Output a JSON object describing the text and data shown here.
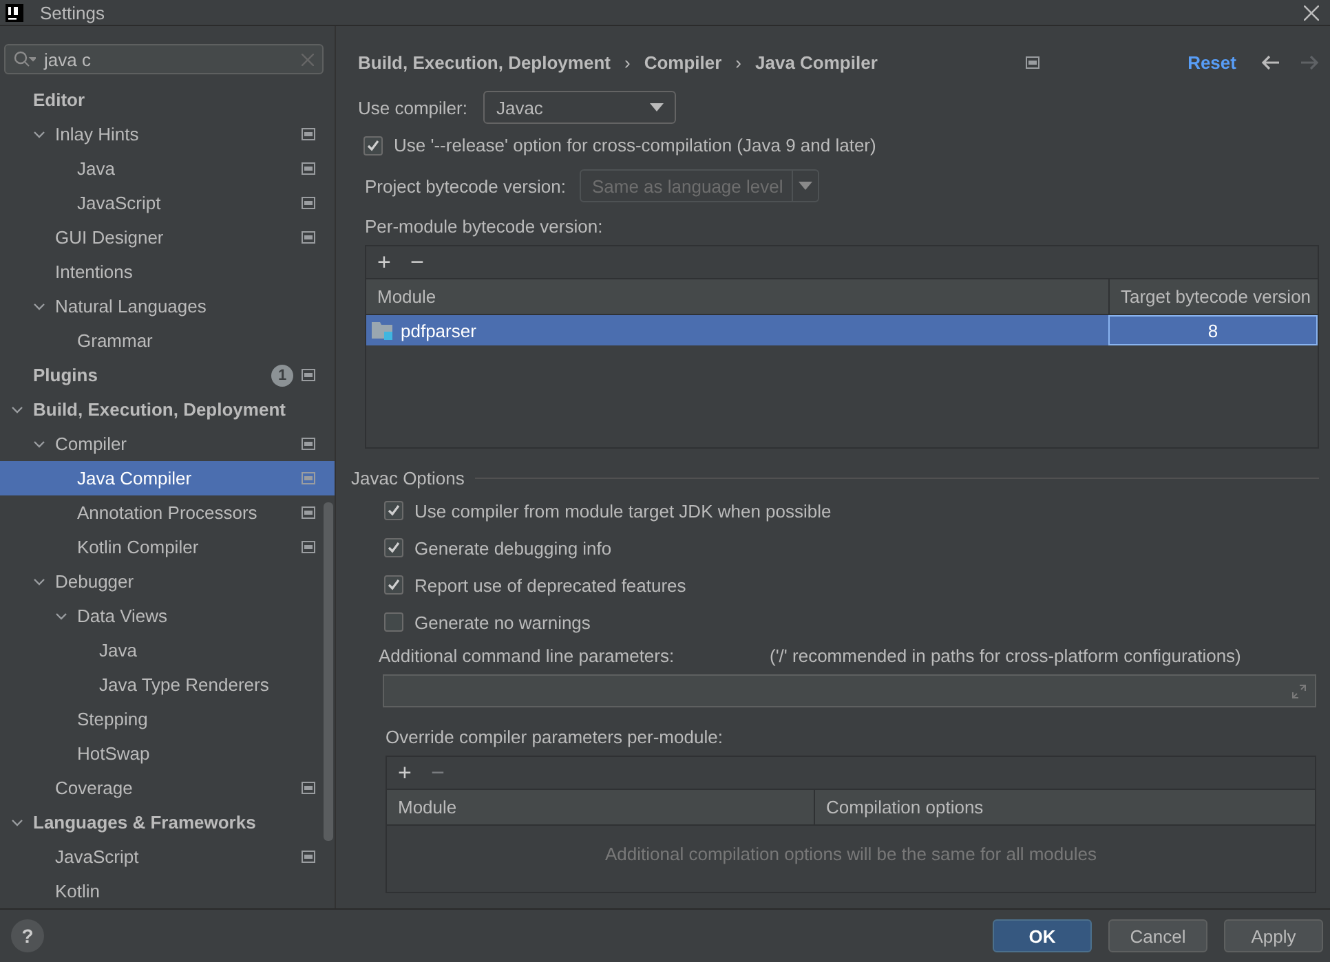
{
  "window": {
    "title": "Settings"
  },
  "search": {
    "value": "java c"
  },
  "sidebar": {
    "items": [
      {
        "label": "Editor",
        "children": [
          {
            "label": "Inlay Hints",
            "expanded": true,
            "project_level": true,
            "children": [
              {
                "label": "Java",
                "project_level": true
              },
              {
                "label": "JavaScript",
                "project_level": true
              }
            ]
          },
          {
            "label": "GUI Designer",
            "project_level": true
          },
          {
            "label": "Intentions",
            "project_level": false
          },
          {
            "label": "Natural Languages",
            "expanded": true,
            "project_level": false,
            "children": [
              {
                "label": "Grammar",
                "project_level": false
              }
            ]
          }
        ]
      },
      {
        "label": "Plugins",
        "badge": "1",
        "project_level": true
      },
      {
        "label": "Build, Execution, Deployment",
        "expanded": true,
        "children": [
          {
            "label": "Compiler",
            "expanded": true,
            "project_level": true,
            "children": [
              {
                "label": "Java Compiler",
                "project_level": true,
                "selected": true
              },
              {
                "label": "Annotation Processors",
                "project_level": true,
                "selected": false
              },
              {
                "label": "Kotlin Compiler",
                "project_level": true,
                "selected": false
              }
            ]
          },
          {
            "label": "Debugger",
            "expanded": true,
            "project_level": false,
            "children": [
              {
                "label": "Data Views",
                "expanded": true,
                "project_level": false,
                "children": [
                  {
                    "label": "Java",
                    "project_level": false
                  },
                  {
                    "label": "Java Type Renderers",
                    "project_level": false
                  }
                ]
              },
              {
                "label": "Stepping",
                "project_level": false
              },
              {
                "label": "HotSwap",
                "project_level": false
              }
            ]
          },
          {
            "label": "Coverage",
            "project_level": true
          }
        ]
      },
      {
        "label": "Languages & Frameworks",
        "expanded": true,
        "children": [
          {
            "label": "JavaScript",
            "project_level": true
          },
          {
            "label": "Kotlin",
            "project_level": false
          }
        ]
      }
    ]
  },
  "breadcrumb": [
    "Build, Execution, Deployment",
    "Compiler",
    "Java Compiler"
  ],
  "breadcrumb_separator": "›",
  "reset_link": "Reset",
  "use_compiler": {
    "label": "Use compiler:",
    "value": "Javac"
  },
  "release_option": {
    "label": "Use '--release' option for cross-compilation (Java 9 and later)",
    "checked": true
  },
  "project_bytecode": {
    "label": "Project bytecode version:",
    "value": "Same as language level",
    "disabled": true
  },
  "per_module": {
    "label": "Per-module bytecode version:",
    "toolbar": [
      {
        "symbol": "+",
        "disabled": false
      },
      {
        "symbol": "−",
        "disabled": false
      }
    ],
    "columns": [
      "Module",
      "Target bytecode version"
    ],
    "rows": [
      {
        "module": "pdfparser",
        "version": "8",
        "selected": true
      }
    ]
  },
  "javac_options": {
    "title": "Javac Options",
    "options": [
      {
        "label": "Use compiler from module target JDK when possible",
        "checked": true
      },
      {
        "label": "Generate debugging info",
        "checked": true
      },
      {
        "label": "Report use of deprecated features",
        "checked": true
      },
      {
        "label": "Generate no warnings",
        "checked": false
      }
    ],
    "params_label": "Additional command line parameters:",
    "params_hint": "('/' recommended in paths for cross-platform configurations)"
  },
  "override": {
    "label": "Override compiler parameters per-module:",
    "toolbar": [
      {
        "symbol": "+",
        "disabled": false
      },
      {
        "symbol": "−",
        "disabled": true
      }
    ],
    "columns": [
      "Module",
      "Compilation options"
    ],
    "empty_text": "Additional compilation options will be the same for all modules"
  },
  "help": "?",
  "buttons": [
    {
      "label": "OK",
      "primary": true
    },
    {
      "label": "Cancel",
      "primary": false
    },
    {
      "label": "Apply",
      "primary": false
    }
  ]
}
